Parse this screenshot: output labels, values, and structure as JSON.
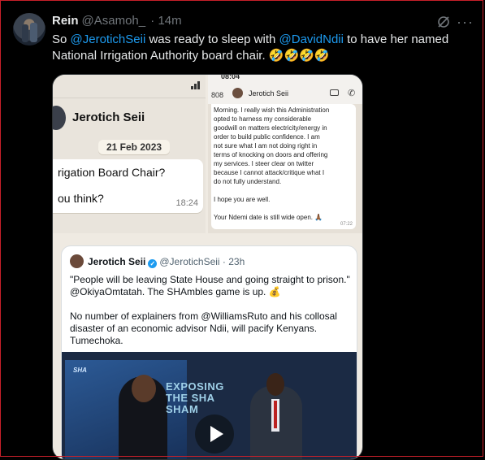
{
  "tweet": {
    "author_name": "Rein",
    "author_handle": "@Asamoh_",
    "time": "· 14m",
    "text_prefix": "So ",
    "mention1": "@JerotichSeii",
    "text_mid": " was ready to sleep with ",
    "mention2": "@DavidNdii",
    "text_suffix": " to have her named National Irrigation Authority board chair. 🤣🤣🤣🤣",
    "more_icon": "more-icon",
    "grok_icon": "grok-icon"
  },
  "wa_left": {
    "contact": "Jerotich Seii",
    "date": "21 Feb 2023",
    "line1": "rigation Board Chair?",
    "line2": "ou think?",
    "time": "18:24"
  },
  "wa_right": {
    "status_time": "08:04",
    "number": "808",
    "contact": "Jerotich Seii",
    "lines": [
      "Morning. I really wish this Administration",
      "opted to harness my considerable",
      "goodwill on matters electricity/energy in",
      "order to build public confidence. I am",
      "not sure what I am not doing right in",
      "terms of knocking on doors and offering",
      "my services. I steer clear on twitter",
      "because I cannot attack/critique what I",
      "do not fully understand.",
      "",
      "I hope you are well.",
      "",
      "Your Ndemi date is still wide open. 🙏🏾"
    ],
    "time": "07:22"
  },
  "quote": {
    "name": "Jerotich Seii",
    "handle": "@JerotichSeii · 23h",
    "para1": "\"People will be leaving State House and going straight to prison.\" @OkiyaOmtatah. The SHAmbles game is up. 💰",
    "para2": "No number of explainers from @WilliamsRuto and his collosal disaster of an economic advisor Ndii, will pacify Kenyans. Tumechoka.",
    "video_title": "EXPOSING THE SHA SHAM",
    "video_logo": "SHA"
  }
}
